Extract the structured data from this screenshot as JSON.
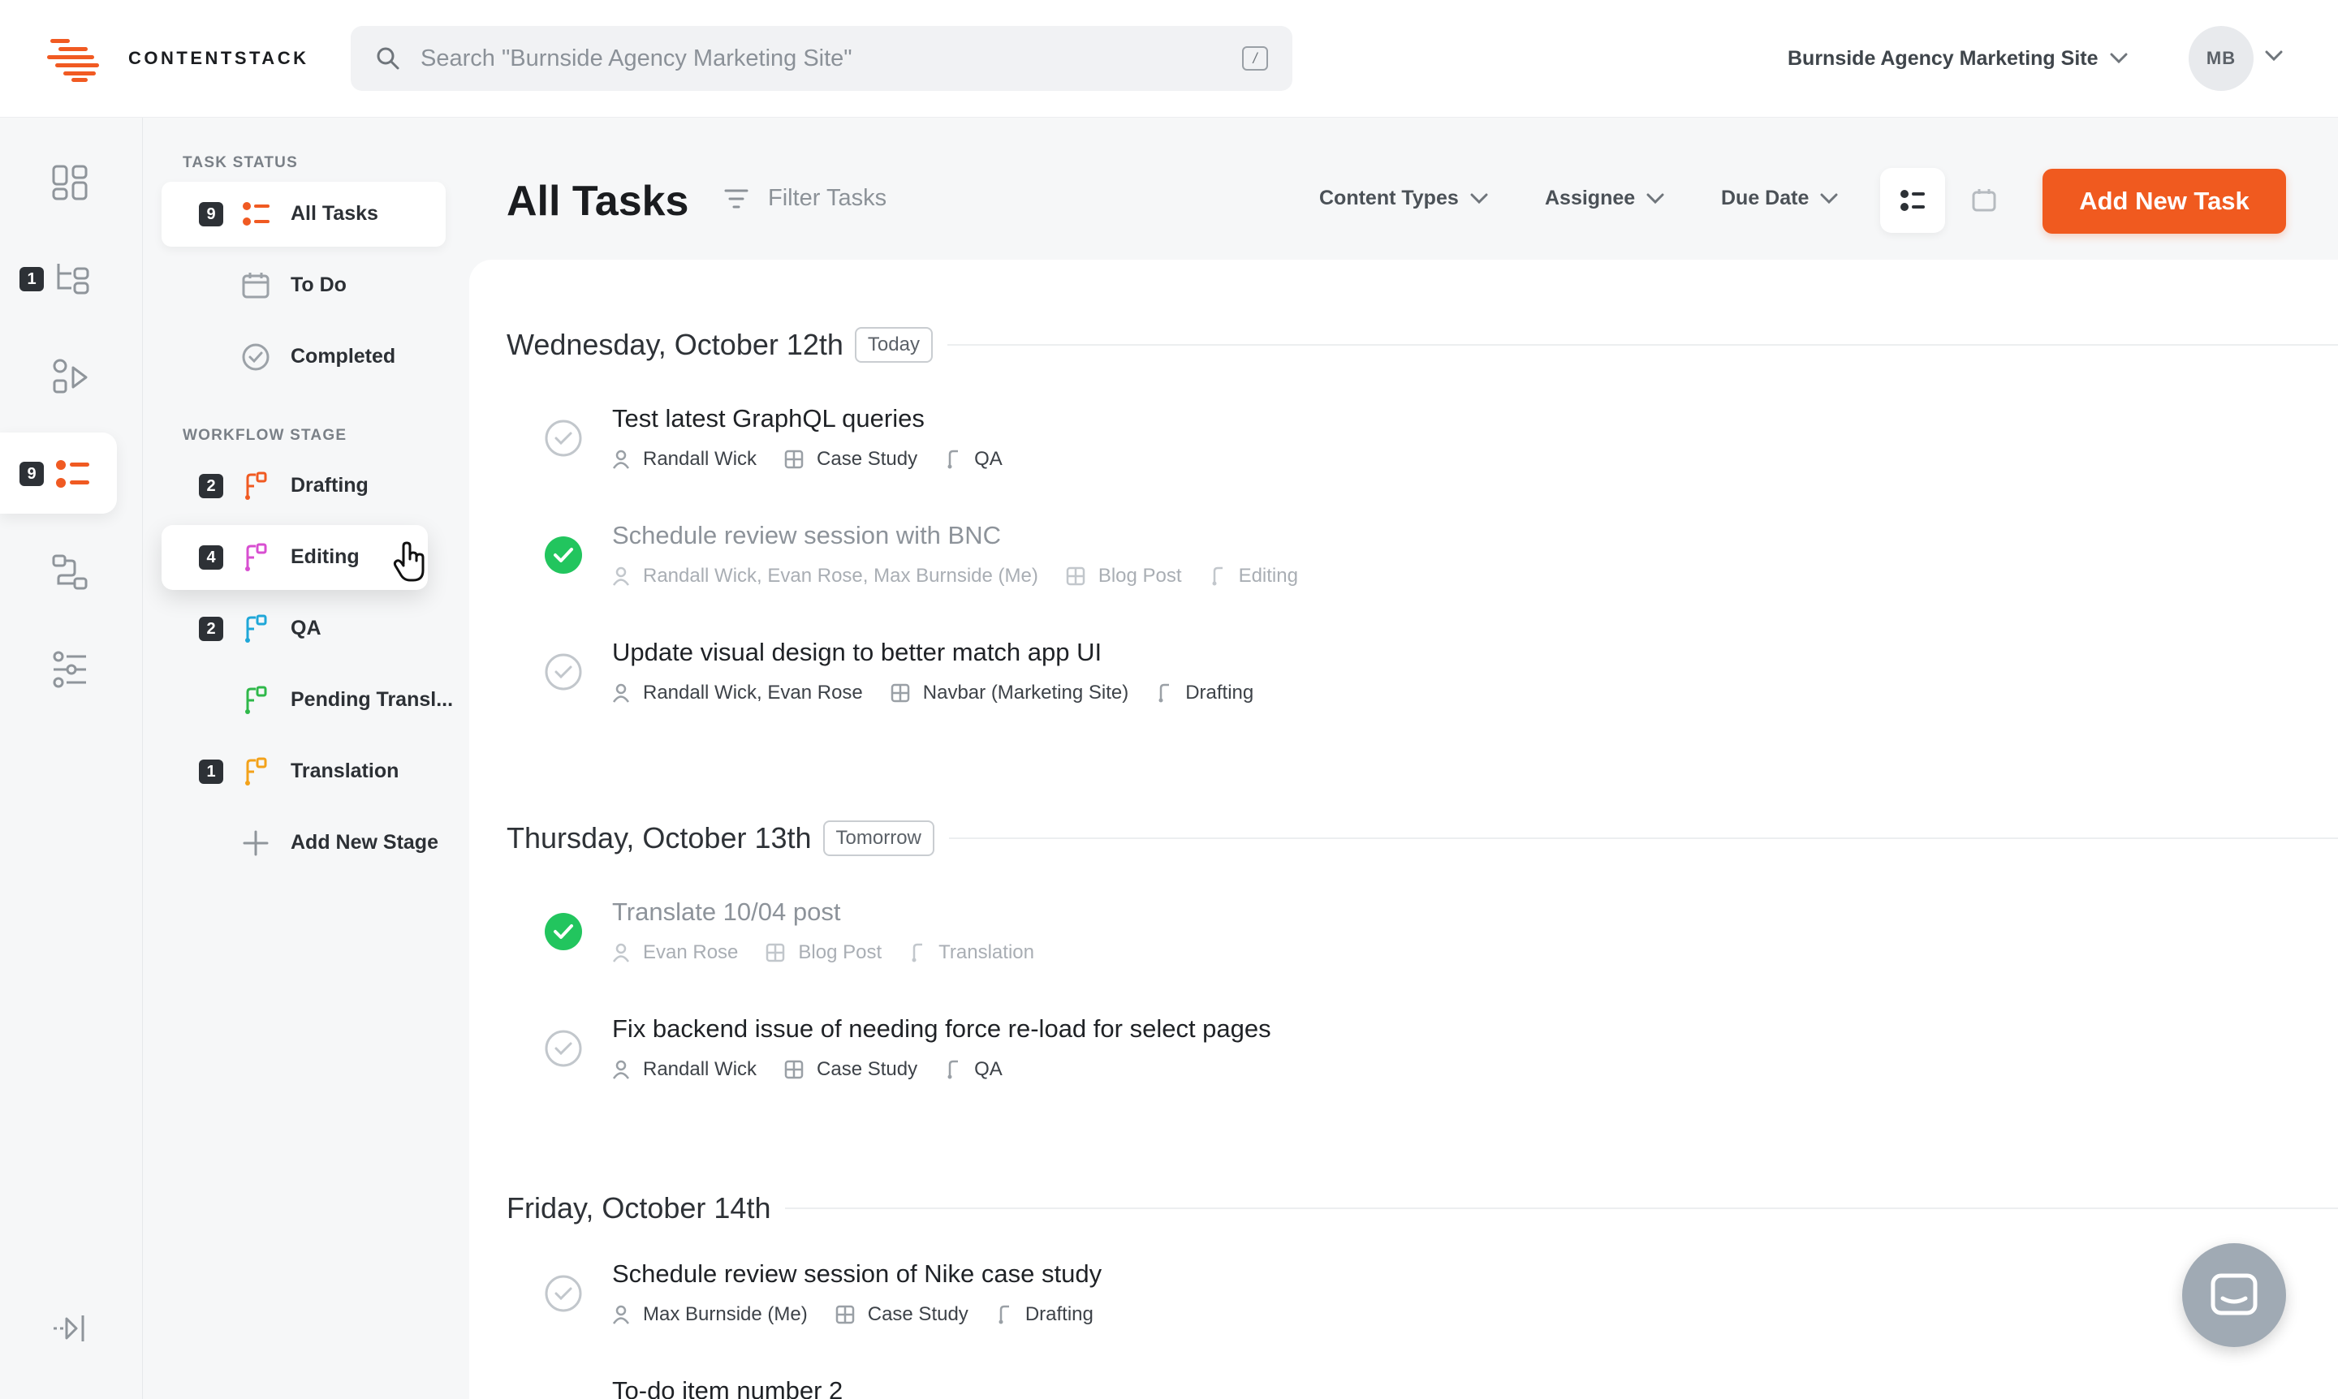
{
  "app": {
    "brand": "CONTENTSTACK",
    "search_placeholder": "Search \"Burnside Agency Marketing Site\"",
    "search_shortcut": "/",
    "stack_name": "Burnside Agency Marketing Site",
    "user_initials": "MB"
  },
  "rail": {
    "entries_badge": "1",
    "tasks_badge": "9"
  },
  "panel": {
    "task_status_label": "TASK STATUS",
    "status_items": [
      {
        "label": "All Tasks",
        "count": "9"
      },
      {
        "label": "To Do"
      },
      {
        "label": "Completed"
      }
    ],
    "workflow_label": "WORKFLOW STAGE",
    "stages": [
      {
        "label": "Drafting",
        "count": "2",
        "color": "#f05a22"
      },
      {
        "label": "Editing",
        "count": "4",
        "color": "#d84fd1"
      },
      {
        "label": "QA",
        "count": "2",
        "color": "#1fa7d8"
      },
      {
        "label": "Pending Transl...",
        "color": "#2fb84a"
      },
      {
        "label": "Translation",
        "count": "1",
        "color": "#f3a21a"
      }
    ],
    "add_stage": "Add New Stage"
  },
  "header": {
    "title": "All Tasks",
    "filter_placeholder": "Filter Tasks",
    "filters": [
      "Content Types",
      "Assignee",
      "Due Date"
    ],
    "add_button": "Add New Task"
  },
  "days": [
    {
      "date": "Wednesday, October 12th",
      "tag": "Today",
      "tasks": [
        {
          "title": "Test latest GraphQL queries",
          "assignee": "Randall Wick",
          "type": "Case Study",
          "stage": "QA",
          "done": false
        },
        {
          "title": "Schedule review session with BNC",
          "assignee": "Randall Wick, Evan Rose, Max Burnside (Me)",
          "type": "Blog Post",
          "stage": "Editing",
          "done": true
        },
        {
          "title": "Update visual design to better match app UI",
          "assignee": "Randall Wick, Evan Rose",
          "type": "Navbar (Marketing Site)",
          "stage": "Drafting",
          "done": false
        }
      ]
    },
    {
      "date": "Thursday, October 13th",
      "tag": "Tomorrow",
      "tasks": [
        {
          "title": "Translate 10/04 post",
          "assignee": "Evan Rose",
          "type": "Blog Post",
          "stage": "Translation",
          "done": true
        },
        {
          "title": "Fix backend issue of needing force re-load for select pages",
          "assignee": "Randall Wick",
          "type": "Case Study",
          "stage": "QA",
          "done": false
        }
      ]
    },
    {
      "date": "Friday, October 14th",
      "tasks": [
        {
          "title": "Schedule review session of Nike case study",
          "assignee": "Max Burnside (Me)",
          "type": "Case Study",
          "stage": "Drafting",
          "done": false
        },
        {
          "title": "To-do item number 2",
          "done": false
        }
      ]
    }
  ],
  "colors": {
    "accent": "#f05a1f",
    "done": "#22c55e"
  }
}
